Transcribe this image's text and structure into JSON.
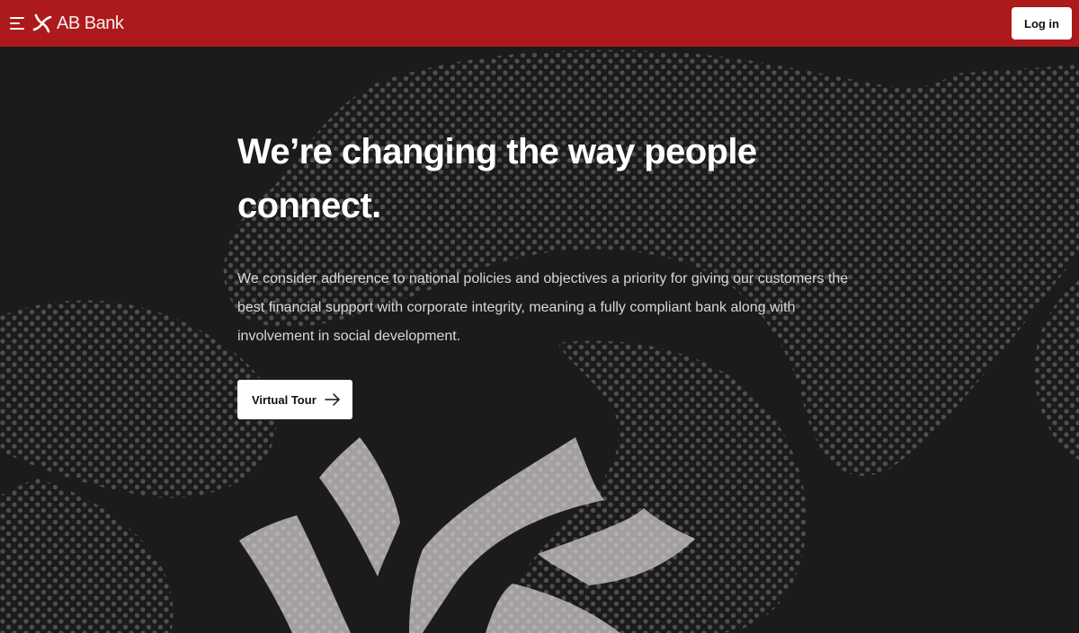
{
  "header": {
    "brand_name": "AB Bank",
    "login_label": "Log in",
    "menu_icon": "hamburger-menu-icon",
    "logo_icon": "ab-bank-logo-icon",
    "background_color": "#ad1a1c"
  },
  "hero": {
    "headline": "We’re changing the way people connect.",
    "description": "We consider adherence to national policies and objectives a priority for giving our customers the best financial support with corporate integrity, meaning a fully compliant bank along with involvement in social development.",
    "cta_label": "Virtual Tour",
    "cta_icon": "arrow-right-icon",
    "background_color": "#1b1b1b",
    "accent_color": "#a39f9f"
  }
}
